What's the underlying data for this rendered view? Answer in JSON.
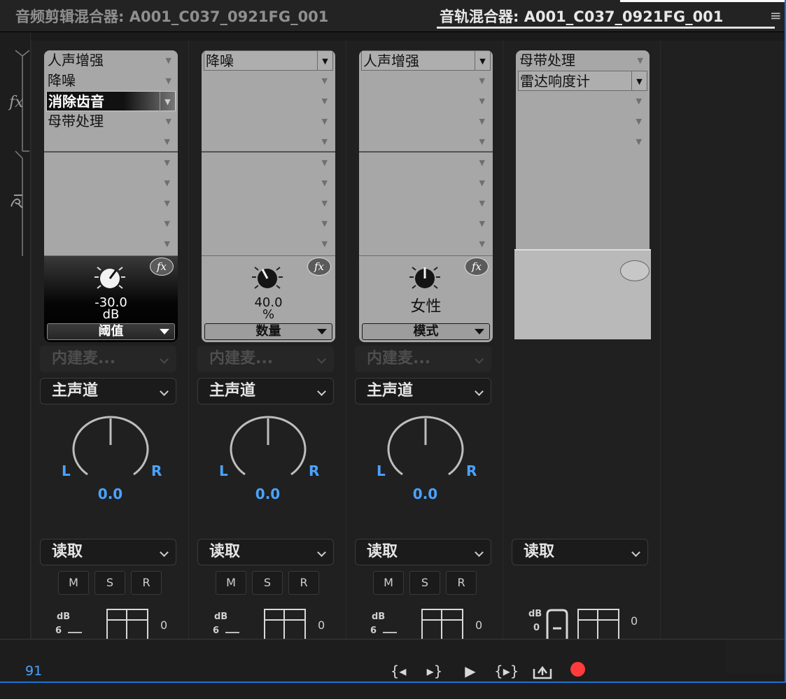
{
  "header": {
    "clip_mixer_tab": "音频剪辑混合器: A001_C037_0921FG_001",
    "track_mixer_tab": "音轨混合器: A001_C037_0921FG_001"
  },
  "gutter": {
    "fx_label": "fx"
  },
  "channels": [
    {
      "effects": [
        "人声增强",
        "降噪",
        "消除齿音",
        "母带处理"
      ],
      "param_value": "-30.0",
      "param_unit": "dB",
      "param_name": "阈值",
      "fx_badge": "fx",
      "input": "内建麦...",
      "output": "主声道",
      "pan_l": "L",
      "pan_r": "R",
      "pan_value": "0.0",
      "automation": "读取",
      "mute": "M",
      "solo": "S",
      "record": "R",
      "db_label": "dB",
      "db_six": "6",
      "meter_zero": "0"
    },
    {
      "effects": [
        "降噪"
      ],
      "param_value": "40.0",
      "param_unit": "%",
      "param_name": "数量",
      "fx_badge": "fx",
      "input": "内建麦...",
      "output": "主声道",
      "pan_l": "L",
      "pan_r": "R",
      "pan_value": "0.0",
      "automation": "读取",
      "mute": "M",
      "solo": "S",
      "record": "R",
      "db_label": "dB",
      "db_six": "6",
      "meter_zero": "0"
    },
    {
      "effects": [
        "人声增强"
      ],
      "param_value": "女性",
      "param_unit": "",
      "param_name": "模式",
      "fx_badge": "fx",
      "input": "内建麦...",
      "output": "主声道",
      "pan_l": "L",
      "pan_r": "R",
      "pan_value": "0.0",
      "automation": "读取",
      "mute": "M",
      "solo": "S",
      "record": "R",
      "db_label": "dB",
      "db_six": "6",
      "meter_zero": "0"
    }
  ],
  "master": {
    "effects": [
      "母带处理",
      "雷达响度计"
    ],
    "automation": "读取",
    "db_label": "dB",
    "db_zero": "0",
    "meter_zero": "0"
  },
  "footer": {
    "timecode": "91"
  },
  "colors": {
    "accent_blue": "#4aa3ff",
    "record_red": "#ff3b3b",
    "panel_border": "#1a74d6"
  },
  "icons": {
    "transport": [
      "go-to-in-icon",
      "go-to-out-icon",
      "play-icon",
      "play-in-to-out-icon",
      "loop-icon",
      "record-icon"
    ]
  }
}
